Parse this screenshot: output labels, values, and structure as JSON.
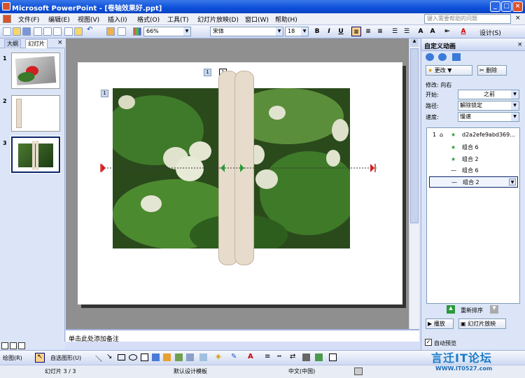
{
  "title_bar": {
    "title": "Microsoft PowerPoint - [卷轴效果好.ppt]"
  },
  "menu": {
    "items": [
      "文件(F)",
      "编辑(E)",
      "视图(V)",
      "插入(I)",
      "格式(O)",
      "工具(T)",
      "幻灯片放映(D)",
      "窗口(W)",
      "帮助(H)"
    ],
    "help_placeholder": "键入需要帮助的问题"
  },
  "toolbar": {
    "zoom": "66%",
    "font_name": "宋体",
    "font_size": "18",
    "bold": "B",
    "italic": "I",
    "underline": "U",
    "design_label": "设计(S)"
  },
  "left_panel": {
    "tabs": [
      "大纲",
      "幻灯片"
    ],
    "close": "×",
    "thumbnails": [
      "1",
      "2",
      "3"
    ]
  },
  "slide": {
    "tag_top": "1",
    "tag_selected": "1",
    "tag_left": "1"
  },
  "notes": {
    "placeholder": "单击此处添加备注"
  },
  "task_pane": {
    "title": "自定义动画",
    "change_label": "更改",
    "delete_label": "删除",
    "modify_label": "修改: 向右",
    "start_label": "开始:",
    "start_value": "之前",
    "path_label": "路径:",
    "path_value": "解除锁定",
    "speed_label": "速度:",
    "speed_value": "慢速",
    "list_items": [
      {
        "num": "1",
        "label": "d2a2efe9abd369..."
      },
      {
        "num": "",
        "label": "组合 6"
      },
      {
        "num": "",
        "label": "组合 2"
      },
      {
        "num": "",
        "label": "组合 6"
      },
      {
        "num": "",
        "label": "组合 2"
      }
    ],
    "reorder_label": "重新排序",
    "play_label": "播放",
    "slideshow_label": "幻灯片放映",
    "autopreview_label": "自动预览"
  },
  "draw_toolbar": {
    "draw_label": "绘图(R)",
    "autoshape_label": "自选图形(U)"
  },
  "status_bar": {
    "slide": "幻灯片 3 / 3",
    "template": "默认设计模板",
    "language": "中文(中国)"
  },
  "watermark": {
    "text": "言迁IT论坛",
    "url": "WWW.IT0527.com"
  },
  "colors": {
    "title_blue": "#0c4fd9",
    "selection": "#ffd38a",
    "path_green": "#2a9a3a",
    "path_red": "#cc2222"
  }
}
